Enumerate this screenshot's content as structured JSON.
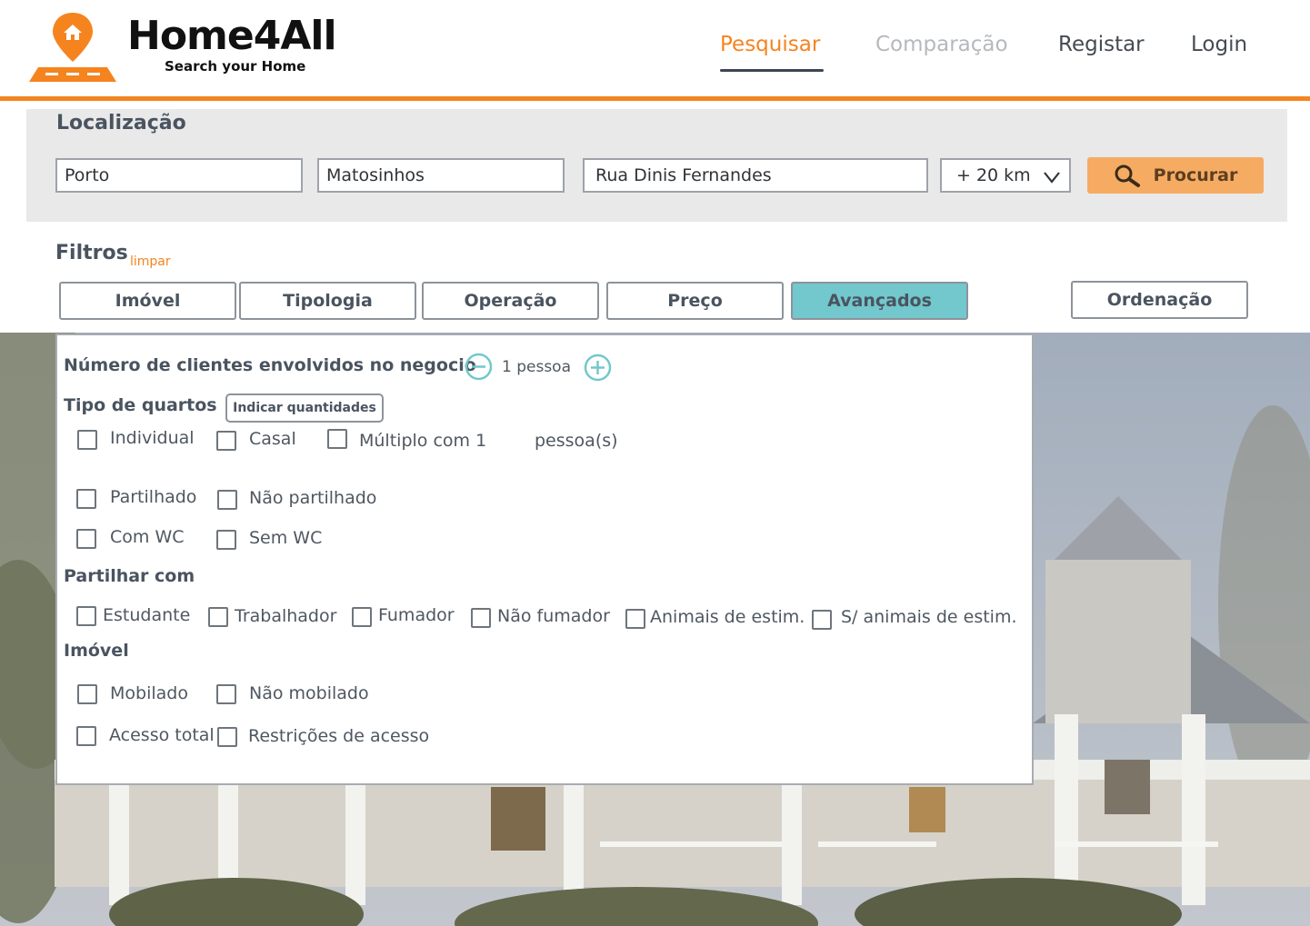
{
  "brand": {
    "name": "Home4All",
    "tagline": "Search your Home"
  },
  "nav": {
    "search": "Pesquisar",
    "compare": "Comparação",
    "register": "Registar",
    "login": "Login"
  },
  "location": {
    "title": "Localização",
    "district": "Porto",
    "municipality": "Matosinhos",
    "street": "Rua Dinis Fernandes",
    "radius": "+ 20 km",
    "search_button": "Procurar"
  },
  "filters": {
    "title": "Filtros",
    "clear": "limpar",
    "tabs": [
      "Imóvel",
      "Tipologia",
      "Operação",
      "Preço",
      "Avançados"
    ],
    "active_tab": "Avançados",
    "sort": "Ordenação"
  },
  "advanced": {
    "clients_label": "Número de clientes envolvidos no negocio",
    "clients_value": "1 pessoa",
    "room_type_title": "Tipo de quartos",
    "indicate_quantities": "Indicar quantidades",
    "room_options": {
      "individual": "Individual",
      "casal": "Casal",
      "multiplo": "Múltiplo com 1",
      "multiplo_suffix": "pessoa(s)",
      "partilhado": "Partilhado",
      "nao_partilhado": "Não partilhado",
      "com_wc": "Com WC",
      "sem_wc": "Sem WC"
    },
    "share_title": "Partilhar com",
    "share_options": [
      "Estudante",
      "Trabalhador",
      "Fumador",
      "Não fumador",
      "Animais de estim.",
      "S/ animais de estim."
    ],
    "property_title": "Imóvel",
    "property_options": {
      "mobilado": "Mobilado",
      "nao_mobilado": "Não mobilado",
      "acesso_total": "Acesso total",
      "restricoes": "Restrições de acesso"
    }
  },
  "colors": {
    "accent": "#f5841f",
    "active_tab": "#72c8cc",
    "search_button": "#f6ab62",
    "stepper": "#72c8cc"
  },
  "icons": [
    "map-pin-logo-icon",
    "magnifier-icon",
    "chevron-down-icon",
    "minus-circle-icon",
    "plus-circle-icon"
  ]
}
